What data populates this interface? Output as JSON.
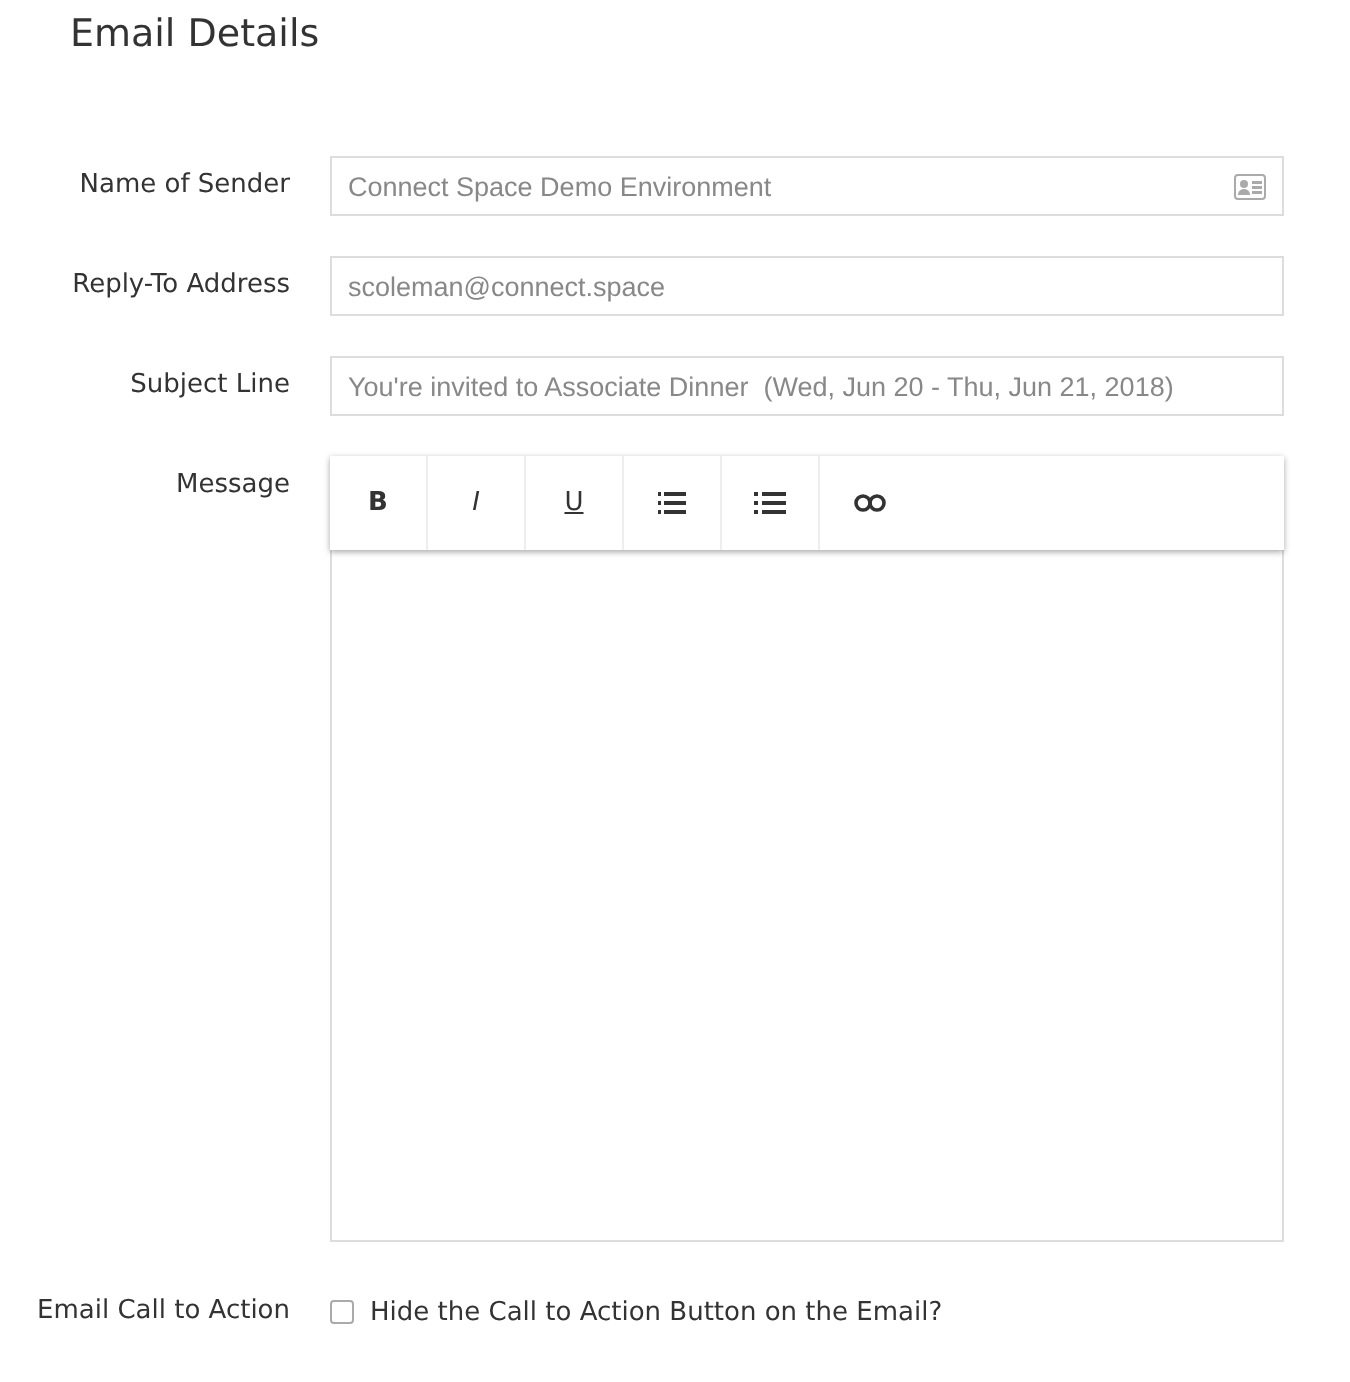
{
  "title": "Email Details",
  "fields": [
    {
      "label": "Name of Sender",
      "placeholder": "Connect Space Demo Environment",
      "kind": "contact"
    },
    {
      "label": "Reply-To Address",
      "placeholder": "scoleman@connect.space",
      "kind": "plain"
    },
    {
      "label": "Subject Line",
      "placeholder": "You're invited to Associate Dinner  (Wed, Jun 20 - Thu, Jun 21, 2018)",
      "kind": "plain"
    }
  ],
  "message": {
    "label": "Message",
    "toolbar": [
      {
        "kind": "bold",
        "label": "B"
      },
      {
        "kind": "italic",
        "label": "I"
      },
      {
        "kind": "underline",
        "label": "U"
      },
      {
        "kind": "ordered-list"
      },
      {
        "kind": "bullet-list"
      },
      {
        "kind": "link"
      }
    ]
  },
  "call_to_action": {
    "label": "Email Call to Action",
    "option": "Hide the Call to Action Button on the Email?",
    "checked": false
  }
}
